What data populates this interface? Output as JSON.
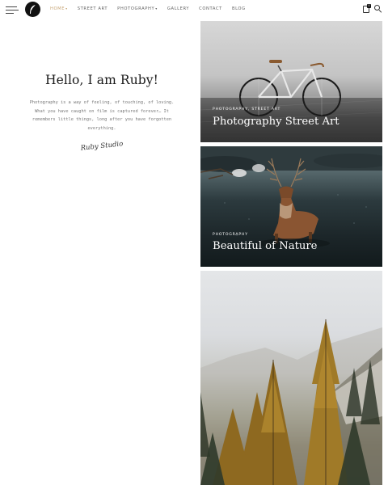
{
  "header": {
    "nav": [
      {
        "label": "HOME",
        "caret": "▾",
        "active": true
      },
      {
        "label": "STREET ART",
        "caret": "",
        "active": false
      },
      {
        "label": "PHOTOGRAPHY",
        "caret": "▾",
        "active": false
      },
      {
        "label": "GALLERY",
        "caret": "",
        "active": false
      },
      {
        "label": "CONTACT",
        "caret": "",
        "active": false
      },
      {
        "label": "BLOG",
        "caret": "",
        "active": false
      }
    ],
    "cart_count": "0",
    "accent_color": "#c8a777",
    "icons": {
      "menu": "hamburger-icon",
      "logo": "feather-logo-icon",
      "cart": "shopping-bag-icon",
      "search": "search-icon"
    }
  },
  "intro": {
    "title": "Hello, I am Ruby!",
    "text": "Photography is a way of feeling, of touching, of loving. What you have caught on film is captured forever… It remembers little things, long after you have forgotten everything.",
    "signature": "Ruby Studio"
  },
  "cards": [
    {
      "category": "PHOTOGRAPHY, STREET ART",
      "title": "Photography Street Art"
    },
    {
      "category": "PHOTOGRAPHY",
      "title": "Beautiful of Nature"
    },
    {
      "category": "",
      "title": ""
    }
  ]
}
